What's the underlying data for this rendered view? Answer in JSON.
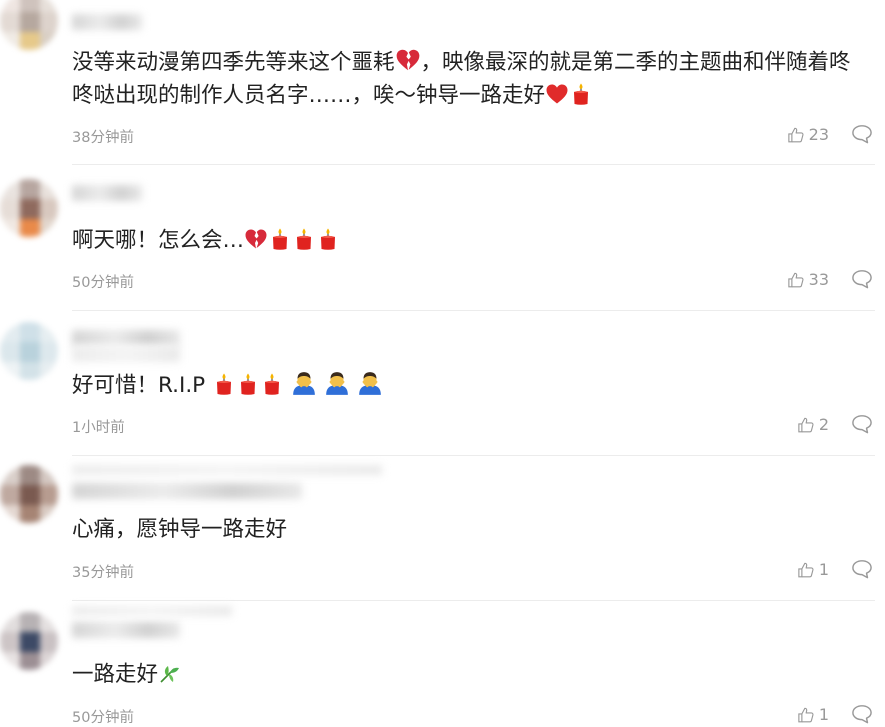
{
  "comments": [
    {
      "text_a": "没等来动漫第四季先等来这个噩耗",
      "text_b": "，映像最深的就是第二季的主题曲和伴随着咚咚哒出现的制作人员名字……，唉～钟导一路走好",
      "time": "38分钟前",
      "likes": "23"
    },
    {
      "text_a": "啊天哪！怎么会…",
      "time": "50分钟前",
      "likes": "33"
    },
    {
      "text_a": "好可惜！R.I.P ",
      "time": "1小时前",
      "likes": "2"
    },
    {
      "text_a": "心痛，愿钟导一路走好",
      "time": "35分钟前",
      "likes": "1"
    },
    {
      "text_a": "一路走好",
      "time": "50分钟前",
      "likes": "1"
    }
  ],
  "colors": {
    "text": "#222222",
    "meta": "#999999",
    "heart": "#e02b2b",
    "candle": "#e0231f",
    "flame": "#f6b400",
    "mourner": "#2f6fd8",
    "leaf": "#4caf50"
  },
  "icons": [
    "broken-heart-icon",
    "red-heart-icon",
    "candle-icon",
    "mourning-person-icon",
    "bamboo-leaf-icon",
    "thumbs-up-icon",
    "reply-bubble-icon"
  ]
}
